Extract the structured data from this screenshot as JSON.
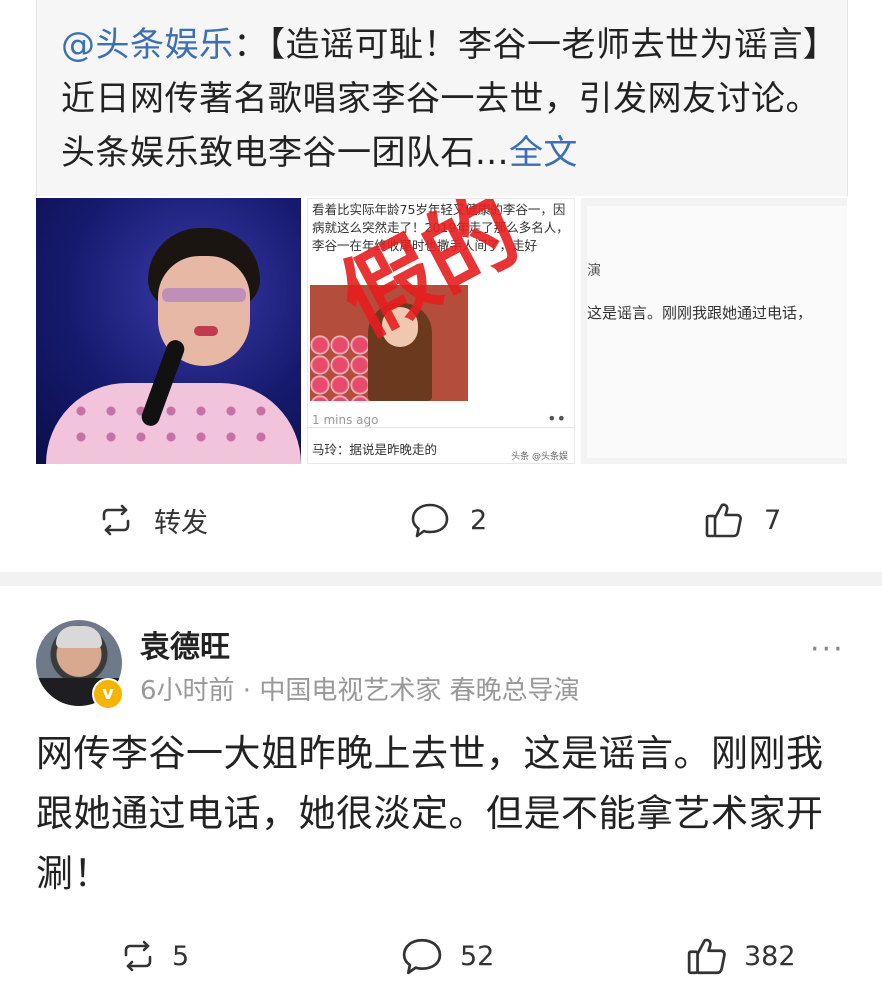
{
  "quote": {
    "mention": "@头条娱乐",
    "colon": "：",
    "text": "【造谣可耻！李谷一老师去世为谣言】近日网传著名歌唱家李谷一去世，引发网友讨论。头条娱乐致电李谷一团队石...",
    "full_text_link": "全文"
  },
  "images": {
    "screenshot": {
      "text": "看着比实际年龄75岁年轻又健康的李谷一，因病就这么突然走了！2019年走了那么多名人，李谷一在年终收尾时也撒手人间了，走好",
      "stamp": "假的",
      "time": "1 mins ago",
      "comment": "马玲：据说是昨晚走的",
      "watermark": "头条 @头条娱"
    },
    "screenshot2": {
      "line1": "演",
      "line2": "这是谣言。刚刚我跟她通过电话，"
    }
  },
  "actions": {
    "repost_label": "转发",
    "comment_count": "2",
    "like_count": "7"
  },
  "post": {
    "author": "袁德旺",
    "meta": "6小时前 · 中国电视艺术家 春晚总导演",
    "badge": "v",
    "more": "···",
    "body": "网传李谷一大姐昨晚上去世，这是谣言。刚刚我跟她通过电话，她很淡定。但是不能拿艺术家开涮！",
    "stats": {
      "repost_count": "5",
      "comment_count": "52",
      "like_count": "382"
    }
  },
  "icons": {
    "repost": "repost-icon",
    "comment": "comment-icon",
    "like": "thumbs-up-icon",
    "more": "more-icon"
  }
}
